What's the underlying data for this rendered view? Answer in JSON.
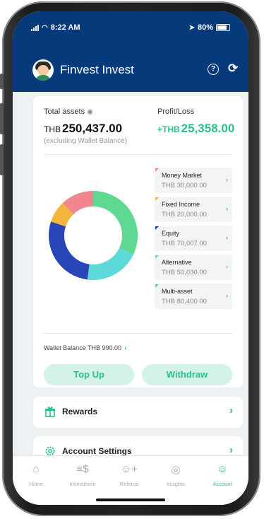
{
  "status_bar": {
    "time": "8:22 AM",
    "battery": "80%"
  },
  "header": {
    "app_title": "Finvest Invest",
    "help_icon": "question-circle-icon",
    "refresh_icon": "refresh-icon"
  },
  "summary": {
    "total_assets_label": "Total assets",
    "currency": "THB",
    "total_assets_value": "250,437.00",
    "excluding_note": "(excluding Wallet Balance)",
    "profit_loss_label": "Profit/Loss",
    "profit_loss_prefix": "+THB",
    "profit_loss_value": "25,358.00"
  },
  "allocation": {
    "items": [
      {
        "name": "Money Market",
        "value": "THB 30,000.00",
        "amount": 30000,
        "color": "#f2868f"
      },
      {
        "name": "Fixed Income",
        "value": "THB 20,000.00",
        "amount": 20000,
        "color": "#f3b53c"
      },
      {
        "name": "Equity",
        "value": "THB 70,007.00",
        "amount": 70007,
        "color": "#2a45b8"
      },
      {
        "name": "Alternative",
        "value": "THB 50,030.00",
        "amount": 50030,
        "color": "#5ed9d9"
      },
      {
        "name": "Multi-asset",
        "value": "THB 80,400.00",
        "amount": 80400,
        "color": "#5fd891"
      }
    ]
  },
  "wallet": {
    "label": "Wallet Balance THB 990.00"
  },
  "actions": {
    "top_up": "Top Up",
    "withdraw": "Withdraw"
  },
  "menu": {
    "rewards": "Rewards",
    "account_settings": "Account Settings"
  },
  "tabs": [
    {
      "label": "Home",
      "icon": "home-icon",
      "active": false
    },
    {
      "label": "Investment",
      "icon": "investment-icon",
      "active": false
    },
    {
      "label": "Referral",
      "icon": "add-user-icon",
      "active": false
    },
    {
      "label": "Insights",
      "icon": "compass-icon",
      "active": false
    },
    {
      "label": "Account",
      "icon": "user-icon",
      "active": true
    }
  ],
  "colors": {
    "brand_blue": "#073a7a",
    "accent_green": "#2bbf8a",
    "pill_bg": "#d3f3e7"
  }
}
